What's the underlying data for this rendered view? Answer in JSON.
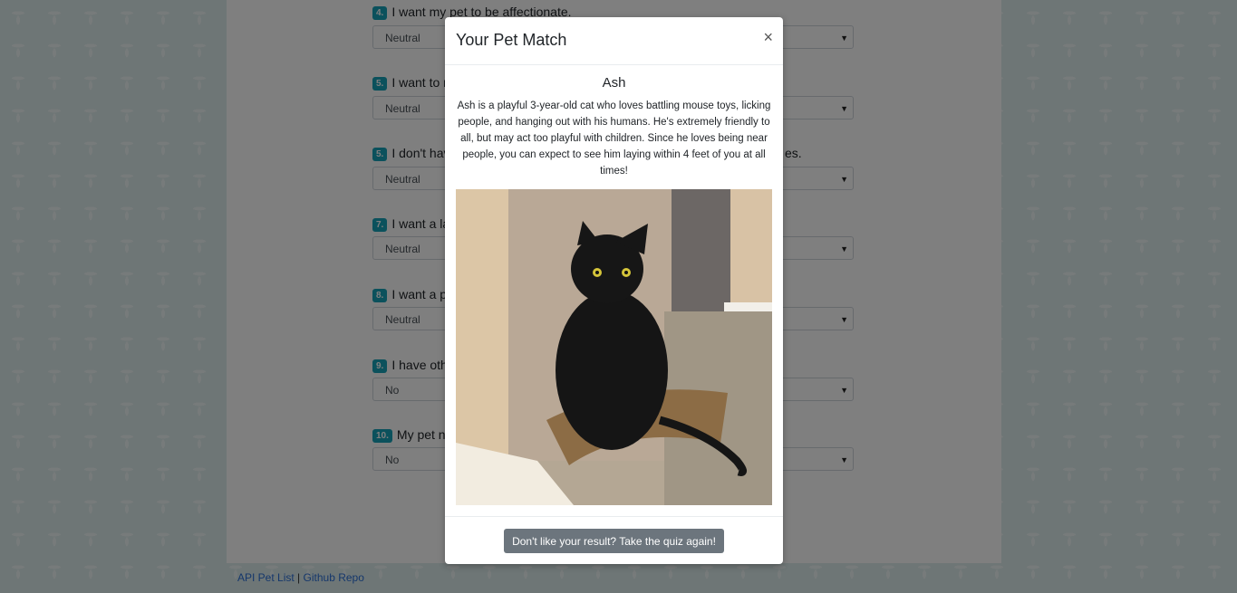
{
  "questions": [
    {
      "num": "4.",
      "label": "I want my pet to be affectionate.",
      "value": "Neutral"
    },
    {
      "num": "5.",
      "label": "I want to r",
      "value": "Neutral"
    },
    {
      "num": "5.",
      "label": "I don't hav",
      "label_right": "es.",
      "value": "Neutral"
    },
    {
      "num": "7.",
      "label": "I want a la",
      "value": "Neutral"
    },
    {
      "num": "8.",
      "label": "I want a p",
      "value": "Neutral"
    },
    {
      "num": "9.",
      "label": "I have oth",
      "value": "No"
    },
    {
      "num": "10.",
      "label": "My pet n",
      "value": "No"
    }
  ],
  "footer": {
    "link1": "API Pet List",
    "sep": "|",
    "link2": "Github Repo"
  },
  "modal": {
    "title": "Your Pet Match",
    "close": "×",
    "pet_name": "Ash",
    "pet_description": "Ash is a playful 3-year-old cat who loves battling mouse toys, licking people, and hanging out with his humans. He's extremely friendly to all, but may act too playful with children. Since he loves being near people, you can expect to see him laying within 4 feet of you at all times!",
    "retry_button": "Don't like your result? Take the quiz again!"
  },
  "icons": {
    "close": "close-icon",
    "caret": "chevron-down-icon"
  },
  "colors": {
    "badge": "#17a2b8",
    "button": "#6c757d",
    "link": "#2a6fd6"
  }
}
